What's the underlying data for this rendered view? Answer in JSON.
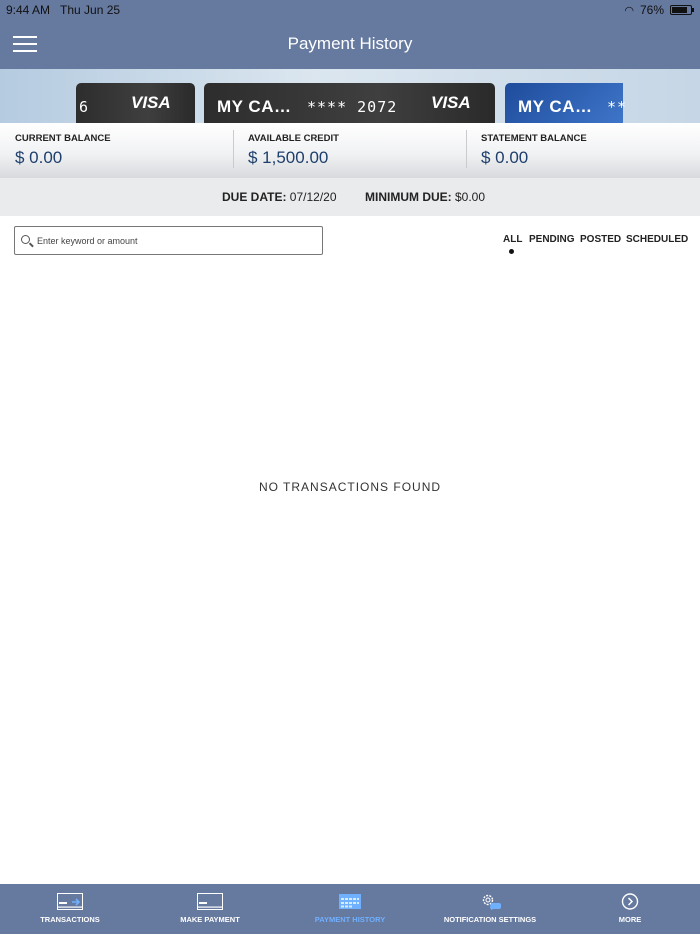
{
  "status_bar": {
    "time": "9:44 AM",
    "date": "Thu Jun 25",
    "battery": "76%"
  },
  "header": {
    "title": "Payment History",
    "menu_icon": "hamburger-menu-icon"
  },
  "cards": [
    {
      "name": "",
      "number": "6",
      "brand": "VISA"
    },
    {
      "name": "MY CA…",
      "number": "**** 2072",
      "brand": "VISA"
    },
    {
      "name": "MY CA…",
      "number": "**",
      "brand": ""
    }
  ],
  "balances": {
    "current": {
      "label": "CURRENT BALANCE",
      "value": "$ 0.00"
    },
    "available": {
      "label": "AVAILABLE CREDIT",
      "value": "$ 1,500.00"
    },
    "statement": {
      "label": "STATEMENT BALANCE",
      "value": "$ 0.00"
    }
  },
  "due": {
    "date_label": "DUE DATE:",
    "date_value": "07/12/20",
    "min_label": "MINIMUM DUE:",
    "min_value": "$0.00"
  },
  "search": {
    "placeholder": "Enter keyword or amount",
    "value": ""
  },
  "filters": {
    "all": "ALL",
    "pending": "PENDING",
    "posted": "POSTED",
    "scheduled": "SCHEDULED",
    "selected": "ALL"
  },
  "empty_message": "NO TRANSACTIONS FOUND",
  "tabs": [
    {
      "label": "TRANSACTIONS",
      "icon": "card-transfer-icon"
    },
    {
      "label": "MAKE PAYMENT",
      "icon": "card-icon"
    },
    {
      "label": "PAYMENT HISTORY",
      "icon": "calendar-icon",
      "active": true
    },
    {
      "label": "NOTIFICATION SETTINGS",
      "icon": "gear-chat-icon"
    },
    {
      "label": "MORE",
      "icon": "chevron-right-circle-icon"
    }
  ],
  "colors": {
    "header_bg": "#66799f",
    "active_tab": "#6fb0ff",
    "value_text": "#1e3f6d"
  }
}
